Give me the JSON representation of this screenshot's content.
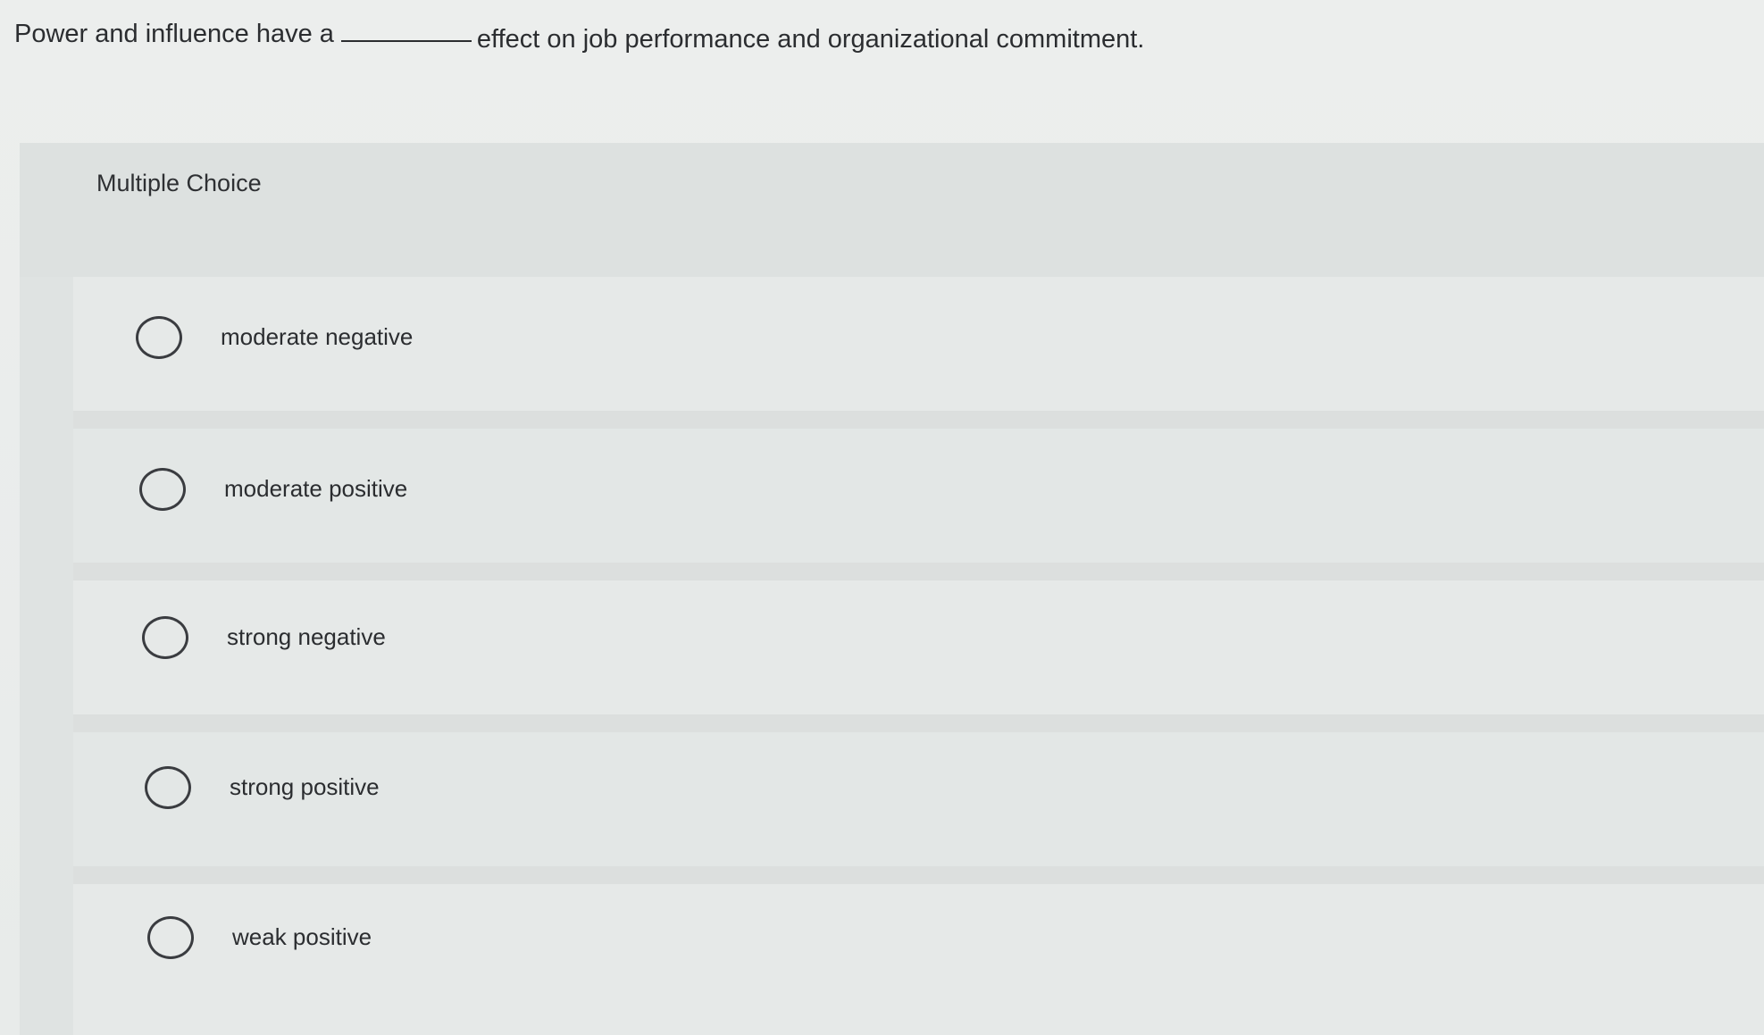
{
  "question": {
    "before_blank": "Power and influence have a",
    "after_blank": "effect on job performance and organizational commitment."
  },
  "question_type": "Multiple Choice",
  "options": [
    {
      "label": "moderate negative"
    },
    {
      "label": "moderate positive"
    },
    {
      "label": "strong negative"
    },
    {
      "label": "strong positive"
    },
    {
      "label": "weak positive"
    }
  ]
}
